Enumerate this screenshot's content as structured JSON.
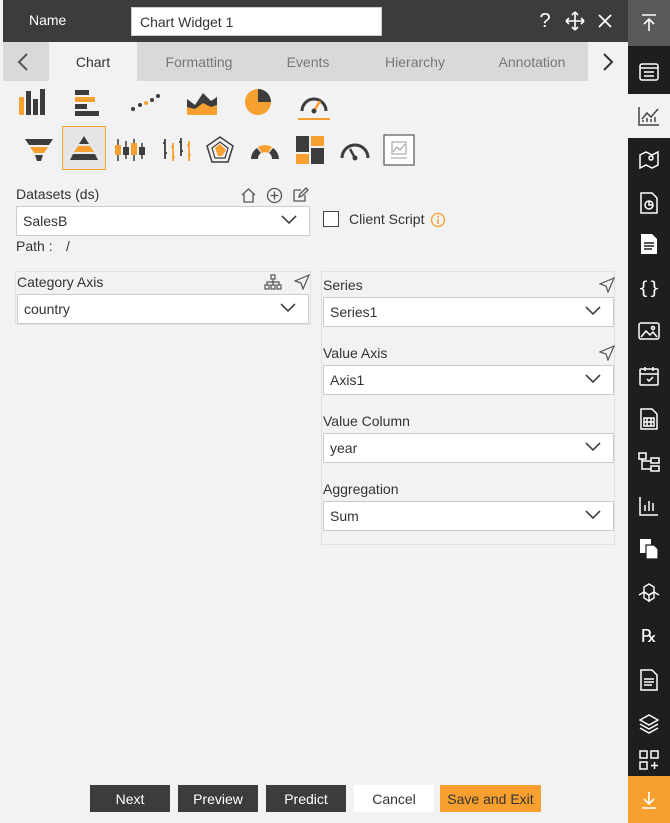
{
  "header": {
    "name_label": "Name",
    "name_value": "Chart Widget 1"
  },
  "tabs": {
    "items": [
      {
        "label": "Chart"
      },
      {
        "label": "Formatting"
      },
      {
        "label": "Events"
      },
      {
        "label": "Hierarchy"
      },
      {
        "label": "Annotation"
      }
    ],
    "active": "Chart"
  },
  "chart_types": {
    "row1": [
      "bar-chart-icon",
      "horizontal-bar-chart-icon",
      "scatter-chart-icon",
      "area-chart-icon",
      "pie-chart-icon",
      "gauge-chart-icon"
    ],
    "row2": [
      "funnel-chart-icon",
      "pyramid-chart-icon",
      "candlestick-chart-icon",
      "ohlc-chart-icon",
      "radar-chart-icon",
      "semi-gauge-chart-icon",
      "treemap-chart-icon",
      "speedometer-chart-icon",
      "custom-chart-icon"
    ],
    "selected": "pyramid-chart-icon"
  },
  "dataset": {
    "label": "Datasets (ds)",
    "value": "SalesB",
    "path_label": "Path :",
    "path_value": "/"
  },
  "client_script": {
    "label": "Client Script",
    "checked": false
  },
  "category_axis": {
    "label": "Category Axis",
    "value": "country"
  },
  "series": {
    "label": "Series",
    "value": "Series1"
  },
  "value_axis": {
    "label": "Value Axis",
    "value": "Axis1"
  },
  "value_column": {
    "label": "Value Column",
    "value": "year"
  },
  "aggregation": {
    "label": "Aggregation",
    "value": "Sum"
  },
  "footer": {
    "next": "Next",
    "preview": "Preview",
    "predict": "Predict",
    "cancel": "Cancel",
    "save_exit": "Save and Exit"
  },
  "colors": {
    "accent": "#f7a030",
    "dark": "#3c3c3c",
    "rail": "#1e1e1e"
  }
}
